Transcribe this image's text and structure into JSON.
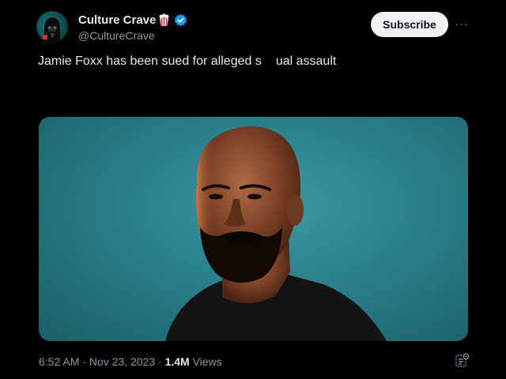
{
  "author": {
    "name": "Culture Crave",
    "handle": "@CultureCrave",
    "badge_emoji": "popcorn-icon",
    "verified_icon": "verified-badge-icon"
  },
  "actions": {
    "subscribe_label": "Subscribe",
    "more_label": "···"
  },
  "post": {
    "text_before": "Jamie Foxx has been sued for alleged s",
    "text_after": "ual assault"
  },
  "meta": {
    "time": "6:52 AM",
    "sep1": " · ",
    "date": "Nov 23, 2023",
    "sep2": " · ",
    "views_count": "1.4M",
    "views_label": " Views"
  },
  "colors": {
    "background": "#000000",
    "text": "#e7e9ea",
    "muted": "#8b98a5",
    "verified": "#1d9bf0",
    "media_bg": "#2a7f89"
  }
}
